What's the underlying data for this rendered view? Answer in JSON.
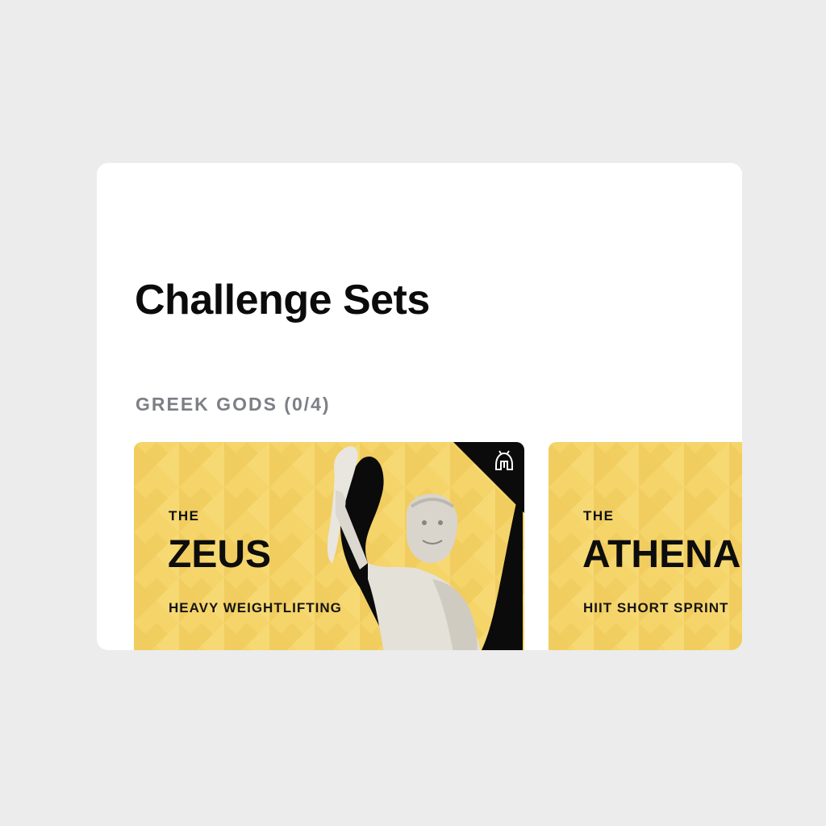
{
  "page": {
    "title": "Challenge Sets"
  },
  "section": {
    "label": "GREEK GODS (0/4)"
  },
  "cards": [
    {
      "prefix": "THE",
      "name": "ZEUS",
      "subtitle": "HEAVY WEIGHTLIFTING",
      "badge_icon": "spartan-helmet-icon"
    },
    {
      "prefix": "THE",
      "name": "ATHENA",
      "subtitle": "HIIT SHORT SPRINT"
    }
  ],
  "colors": {
    "background": "#ececec",
    "panel": "#ffffff",
    "card": "#f5d46a",
    "section_label": "#7c7f86",
    "title": "#0b0b0b"
  }
}
